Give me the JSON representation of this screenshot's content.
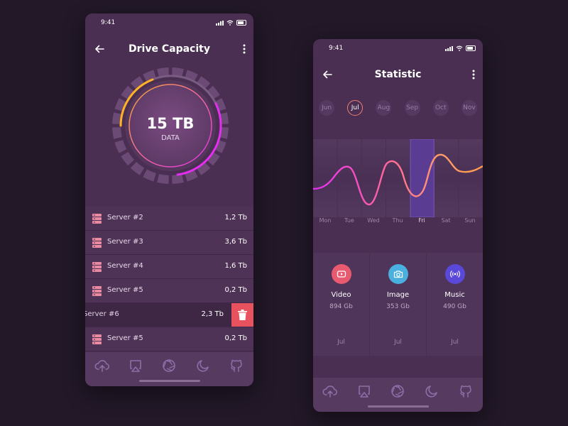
{
  "left": {
    "status_time": "9:41",
    "title": "Drive Capacity",
    "gauge": {
      "value": "15 TB",
      "unit": "DATA"
    },
    "servers": [
      {
        "name": "Server #2",
        "size": "1,2 Tb"
      },
      {
        "name": "Server #3",
        "size": "3,6 Tb"
      },
      {
        "name": "Server #4",
        "size": "1,6 Tb"
      },
      {
        "name": "Server #5",
        "size": "0,2 Tb"
      },
      {
        "name": "Server #6",
        "size": "2,3 Tb"
      },
      {
        "name": "Server #5",
        "size": "0,2 Tb"
      }
    ]
  },
  "right": {
    "status_time": "9:41",
    "title": "Statistic",
    "months": [
      "Jun",
      "Jul",
      "Aug",
      "Sep",
      "Oct",
      "Nov"
    ],
    "selected_month": "Jul",
    "days": [
      "Mon",
      "Tue",
      "Wed",
      "Thu",
      "Fri",
      "Sat",
      "Sun"
    ],
    "selected_day": "Fri",
    "stats": [
      {
        "label": "Video",
        "value": "894 Gb",
        "month": "Jul",
        "icon": "video-icon",
        "color": "#e85a70"
      },
      {
        "label": "Image",
        "value": "353 Gb",
        "month": "Jul",
        "icon": "camera-icon",
        "color": "#4ab0e0"
      },
      {
        "label": "Music",
        "value": "490 Gb",
        "month": "Jul",
        "icon": "broadcast-icon",
        "color": "#5a48d8"
      }
    ]
  },
  "nav_icons": [
    "cloud-upload-icon",
    "airplay-icon",
    "aperture-icon",
    "moon-icon",
    "github-icon"
  ],
  "colors": {
    "background": "#221828",
    "card": "#4a2f52",
    "gradient_start": "#ffb224",
    "gradient_end": "#e62ef2",
    "delete": "#e8525e",
    "selected_bar": "#5a3c92"
  }
}
